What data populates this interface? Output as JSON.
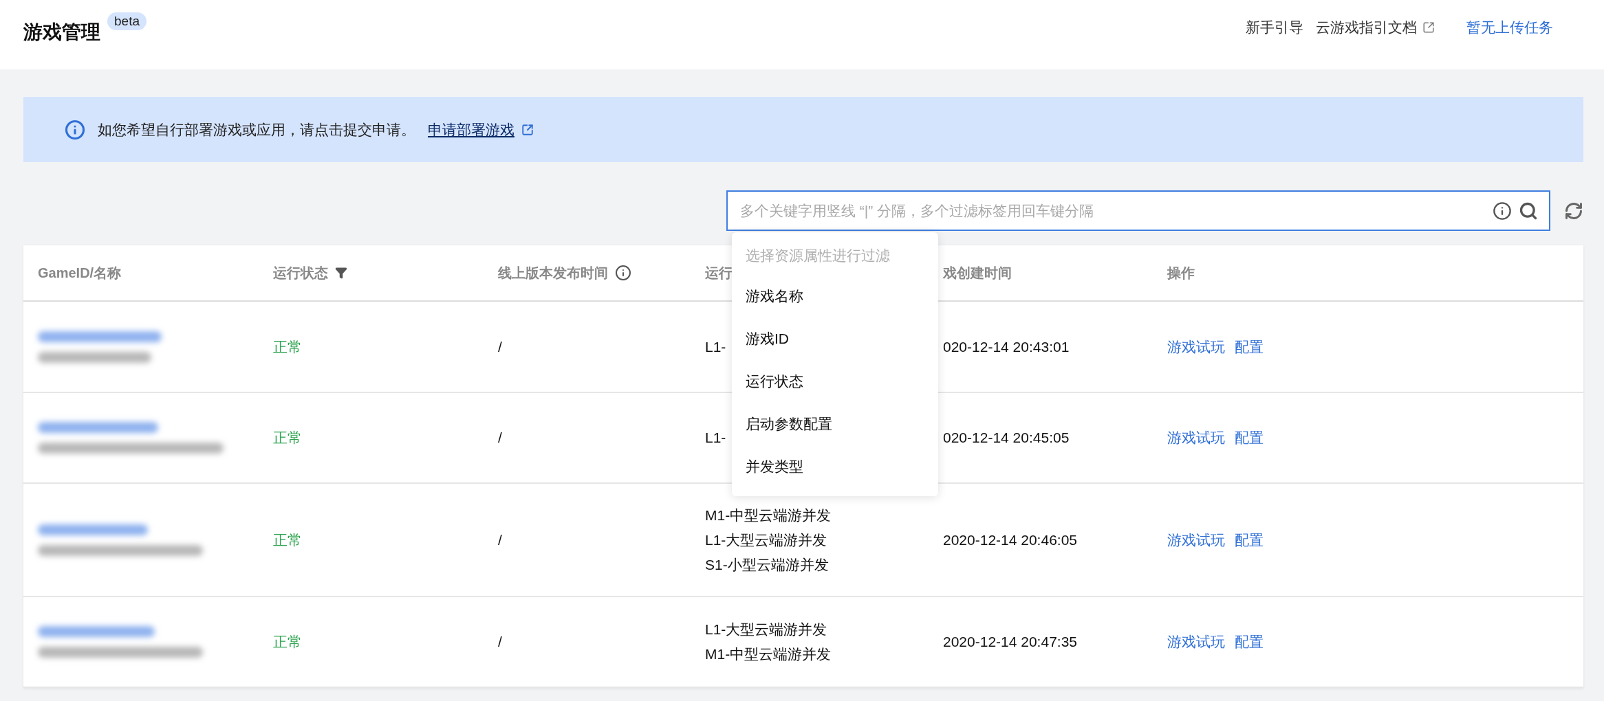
{
  "header": {
    "title": "游戏管理",
    "badge": "beta",
    "links": [
      {
        "label": "新手引导",
        "kind": "plain"
      },
      {
        "label": "云游戏指引文档",
        "kind": "external"
      },
      {
        "label": "暂无上传任务",
        "kind": "primary"
      }
    ]
  },
  "notice": {
    "text": "如您希望自行部署游戏或应用，请点击提交申请。",
    "link": "申请部署游戏"
  },
  "search": {
    "placeholder": "多个关键字用竖线 “|” 分隔，多个过滤标签用回车键分隔"
  },
  "filter_menu": {
    "heading": "选择资源属性进行过滤",
    "items": [
      "游戏名称",
      "游戏ID",
      "运行状态",
      "启动参数配置",
      "并发类型"
    ]
  },
  "table": {
    "columns": [
      {
        "label": "GameID/名称",
        "kind": "plain"
      },
      {
        "label": "运行状态",
        "kind": "filter"
      },
      {
        "label": "线上版本发布时间",
        "kind": "info"
      },
      {
        "label": "运行",
        "kind": "plain"
      },
      {
        "label": "戏创建时间",
        "kind": "plain"
      },
      {
        "label": "操作",
        "kind": "plain"
      }
    ],
    "rows": [
      {
        "status": "正常",
        "release": "/",
        "concurrency": [
          "L1-"
        ],
        "created": "020-12-14 20:43:01",
        "actions": [
          "游戏试玩",
          "配置"
        ]
      },
      {
        "status": "正常",
        "release": "/",
        "concurrency": [
          "L1-"
        ],
        "created": "020-12-14 20:45:05",
        "actions": [
          "游戏试玩",
          "配置"
        ]
      },
      {
        "status": "正常",
        "release": "/",
        "concurrency": [
          "M1-中型云端游并发",
          "L1-大型云端游并发",
          "S1-小型云端游并发"
        ],
        "created": "2020-12-14 20:46:05",
        "actions": [
          "游戏试玩",
          "配置"
        ]
      },
      {
        "status": "正常",
        "release": "/",
        "concurrency": [
          "L1-大型云端游并发",
          "M1-中型云端游并发"
        ],
        "created": "2020-12-14 20:47:35",
        "actions": [
          "游戏试玩",
          "配置"
        ]
      }
    ]
  }
}
